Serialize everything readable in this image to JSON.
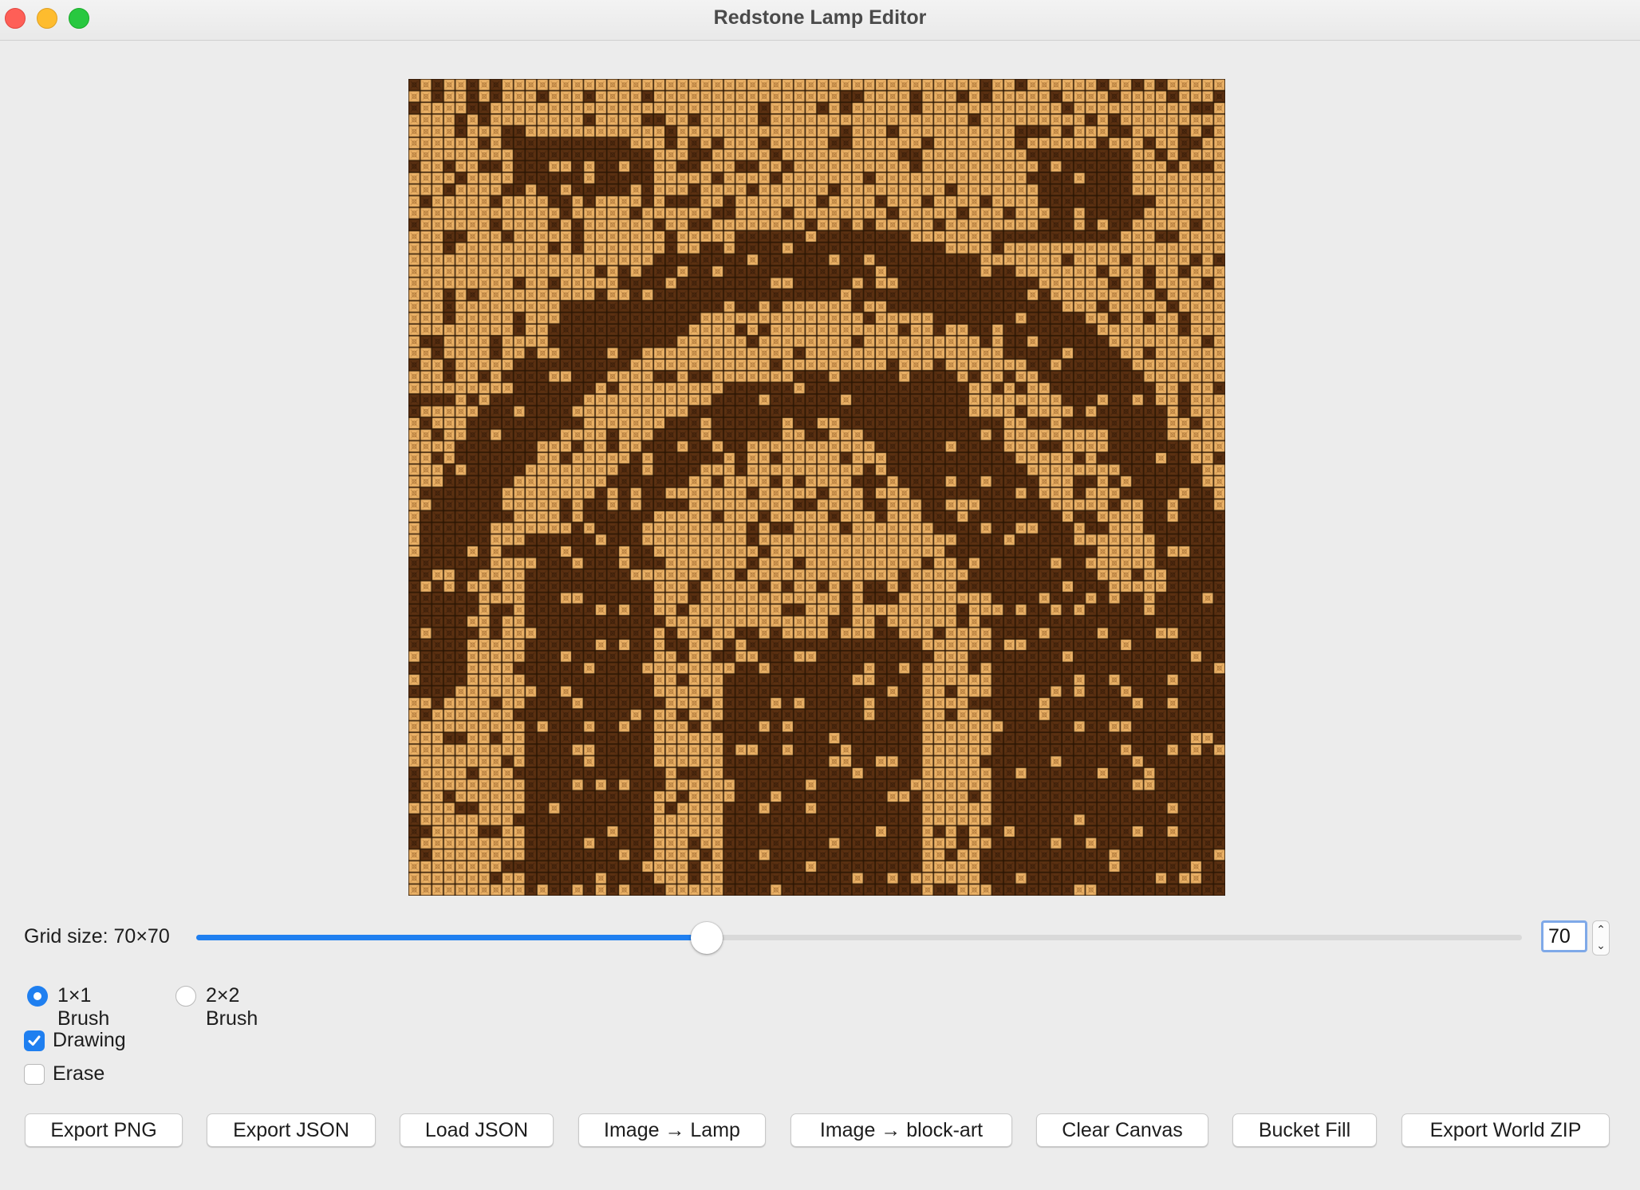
{
  "window": {
    "title": "Redstone Lamp Editor"
  },
  "colors": {
    "lamp_on": "#eeb468",
    "lamp_off": "#5c3112",
    "accent": "#1f7ff0"
  },
  "canvas": {
    "rows": 70,
    "cols": 70
  },
  "grid_size": {
    "label": "Grid size: 70×70",
    "slider_fraction": 0.385,
    "spin_value": "70"
  },
  "brush": {
    "options": [
      {
        "label": "1×1 Brush",
        "selected": true
      },
      {
        "label": "2×2 Brush",
        "selected": false
      }
    ]
  },
  "modes": [
    {
      "label": "Drawing",
      "checked": true
    },
    {
      "label": "Erase",
      "checked": false
    }
  ],
  "buttons": {
    "export_png": "Export PNG",
    "export_json": "Export JSON",
    "load_json": "Load JSON",
    "image_to_lamp": "Image → Lamp",
    "image_to_block_art": "Image → block-art",
    "clear_canvas": "Clear Canvas",
    "bucket_fill": "Bucket Fill",
    "export_world_zip": "Export World ZIP"
  }
}
